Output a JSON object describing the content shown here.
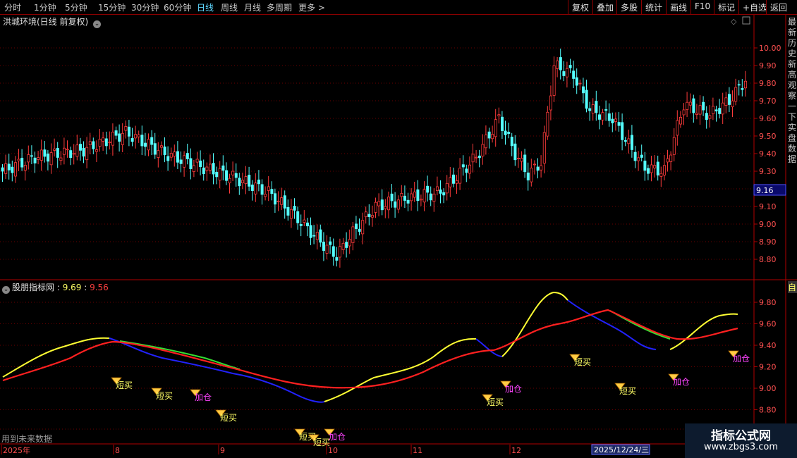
{
  "toolbar": {
    "periods": [
      "分时",
      "1分钟",
      "5分钟",
      "15分钟",
      "30分钟",
      "60分钟",
      "日线",
      "周线",
      "月线",
      "多周期",
      "更多 >"
    ],
    "active_period": "日线",
    "actions": [
      "复权",
      "叠加",
      "多股",
      "统计",
      "画线",
      "F10",
      "标记",
      "+自选",
      "返回"
    ]
  },
  "main_chart": {
    "title": "洪城环境(日线 前复权)",
    "price_labels": [
      "10.00",
      "9.90",
      "9.80",
      "9.70",
      "9.60",
      "9.50",
      "9.40",
      "9.30",
      "9.20",
      "9.10",
      "9.00",
      "8.90",
      "8.80"
    ],
    "current_price": "9.16",
    "side_text": "最新历史新高观察一下实盘数据",
    "colors": {
      "up": "#ff3b3b",
      "down": "#54ffff",
      "grid": "#7a0000",
      "border": "#b00000"
    }
  },
  "indicator": {
    "title": "股朋指标网",
    "value1": "9.69",
    "value2": "9.56",
    "axis_labels": [
      "9.80",
      "9.60",
      "9.40",
      "9.20",
      "9.00",
      "8.80"
    ],
    "side_char": "自",
    "note": "用到未来数据",
    "signals": [
      {
        "text": "短买",
        "color": "#ffff66"
      },
      {
        "text": "短买",
        "color": "#ffff66"
      },
      {
        "text": "加仓",
        "color": "#ff44ff"
      },
      {
        "text": "短买",
        "color": "#ffff66"
      },
      {
        "text": "短买",
        "color": "#ffff66"
      },
      {
        "text": "短买",
        "color": "#ffff66"
      },
      {
        "text": "加仓",
        "color": "#ff44ff"
      },
      {
        "text": "短买",
        "color": "#ffff66"
      },
      {
        "text": "加仓",
        "color": "#ff44ff"
      },
      {
        "text": "短买",
        "color": "#ffff66"
      },
      {
        "text": "短买",
        "color": "#ffff66"
      },
      {
        "text": "加仓",
        "color": "#ff44ff"
      },
      {
        "text": "加仓",
        "color": "#ff44ff"
      }
    ]
  },
  "time_axis": {
    "labels": [
      "2025年",
      "8",
      "9",
      "10",
      "11",
      "12"
    ],
    "cursor_date": "2025/12/24/三"
  },
  "watermark": {
    "line1": "指标公式网",
    "line2": "www.zbgs3.com"
  }
}
